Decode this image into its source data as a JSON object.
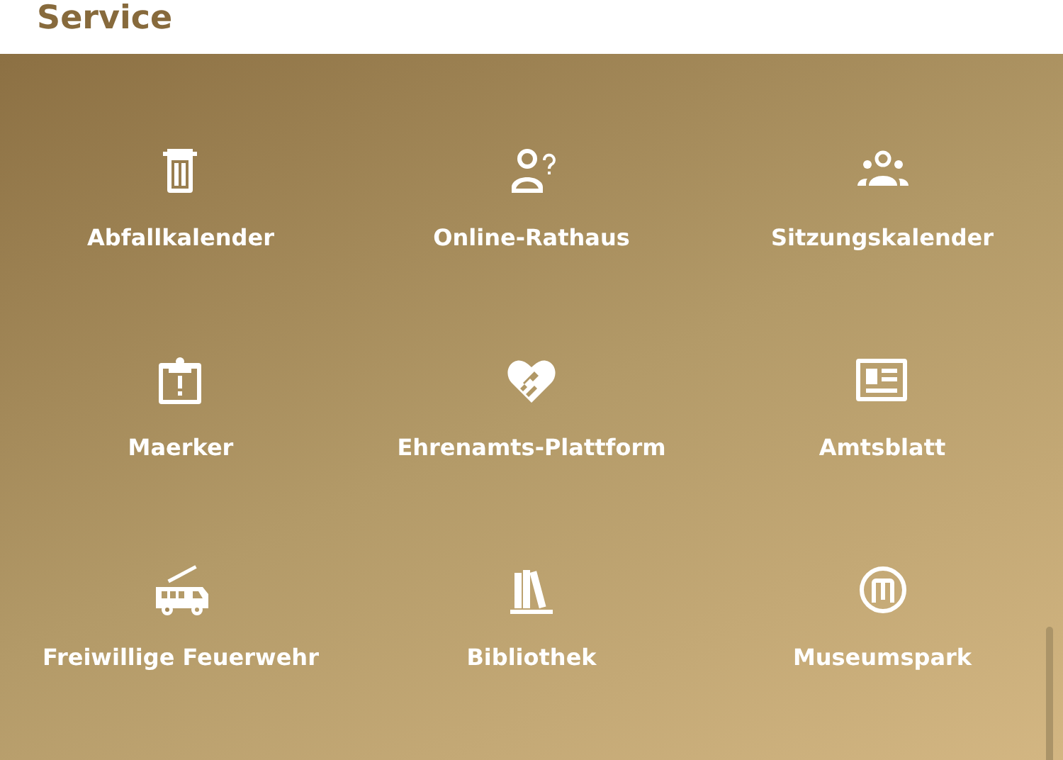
{
  "header": {
    "title": "Service"
  },
  "services": [
    {
      "label": "Abfallkalender"
    },
    {
      "label": "Online-Rathaus"
    },
    {
      "label": "Sitzungskalender"
    },
    {
      "label": "Maerker"
    },
    {
      "label": "Ehrenamts-Plattform"
    },
    {
      "label": "Amtsblatt"
    },
    {
      "label": "Freiwillige Feuerwehr"
    },
    {
      "label": "Bibliothek"
    },
    {
      "label": "Museumspark"
    }
  ]
}
